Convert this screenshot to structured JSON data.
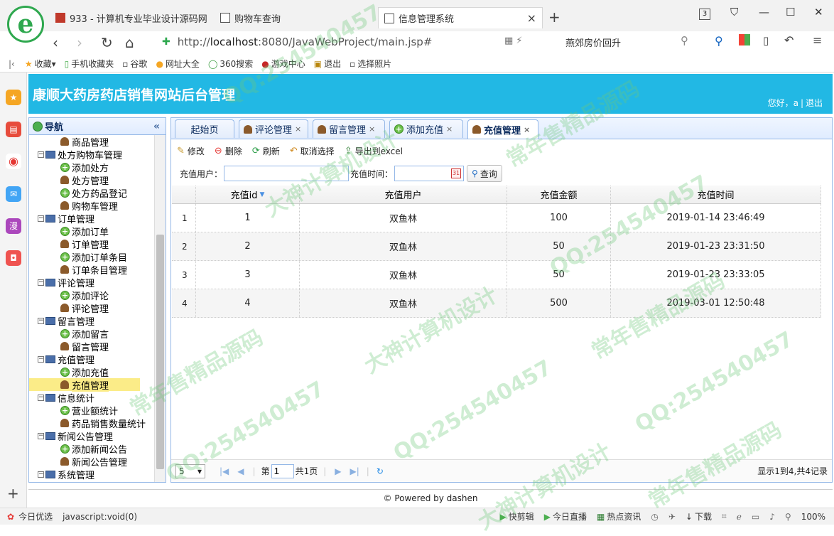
{
  "browser": {
    "tabs": [
      {
        "title": "933 - 计算机专业毕业设计源码网"
      },
      {
        "title": "购物车查询"
      },
      {
        "title": "信息管理系统"
      }
    ],
    "tab_count": "3",
    "url_scheme": "http://",
    "url_host": "localhost",
    "url_rest": ":8080/JavaWebProject/main.jsp#",
    "news_hint": "燕郊房价回升",
    "bookmarks": [
      "收藏",
      "手机收藏夹",
      "谷歌",
      "网址大全",
      "360搜索",
      "游戏中心",
      "退出",
      "选择照片"
    ],
    "status_left": "今日优选",
    "status_link": "javascript:void(0)",
    "status_items": [
      "快剪辑",
      "今日直播",
      "热点资讯",
      "下载"
    ],
    "zoom": "100%"
  },
  "app": {
    "title": "康顺大药房药店销售网站后台管理",
    "greeting": "您好，a",
    "logout": "退出",
    "nav_title": "导航",
    "footer": "© Powered by dashen"
  },
  "tree": [
    {
      "level": 2,
      "icon": "user",
      "label": "商品管理"
    },
    {
      "level": 1,
      "icon": "folder",
      "label": "处方购物车管理"
    },
    {
      "level": 2,
      "icon": "add",
      "label": "添加处方"
    },
    {
      "level": 2,
      "icon": "user",
      "label": "处方管理"
    },
    {
      "level": 2,
      "icon": "add",
      "label": "处方药品登记"
    },
    {
      "level": 2,
      "icon": "user",
      "label": "购物车管理"
    },
    {
      "level": 1,
      "icon": "folder",
      "label": "订单管理"
    },
    {
      "level": 2,
      "icon": "add",
      "label": "添加订单"
    },
    {
      "level": 2,
      "icon": "user",
      "label": "订单管理"
    },
    {
      "level": 2,
      "icon": "add",
      "label": "添加订单条目"
    },
    {
      "level": 2,
      "icon": "user",
      "label": "订单条目管理"
    },
    {
      "level": 1,
      "icon": "folder",
      "label": "评论管理"
    },
    {
      "level": 2,
      "icon": "add",
      "label": "添加评论"
    },
    {
      "level": 2,
      "icon": "user",
      "label": "评论管理"
    },
    {
      "level": 1,
      "icon": "folder",
      "label": "留言管理"
    },
    {
      "level": 2,
      "icon": "add",
      "label": "添加留言"
    },
    {
      "level": 2,
      "icon": "user",
      "label": "留言管理"
    },
    {
      "level": 1,
      "icon": "folder",
      "label": "充值管理"
    },
    {
      "level": 2,
      "icon": "add",
      "label": "添加充值"
    },
    {
      "level": 2,
      "icon": "user",
      "label": "充值管理",
      "selected": true
    },
    {
      "level": 1,
      "icon": "folder",
      "label": "信息统计"
    },
    {
      "level": 2,
      "icon": "add",
      "label": "营业额统计"
    },
    {
      "level": 2,
      "icon": "user",
      "label": "药品销售数量统计"
    },
    {
      "level": 1,
      "icon": "folder",
      "label": "新闻公告管理"
    },
    {
      "level": 2,
      "icon": "add",
      "label": "添加新闻公告"
    },
    {
      "level": 2,
      "icon": "user",
      "label": "新闻公告管理"
    },
    {
      "level": 1,
      "icon": "folder",
      "label": "系统管理"
    }
  ],
  "page_tabs": [
    {
      "label": "起始页",
      "icon": "",
      "closable": false
    },
    {
      "label": "评论管理",
      "icon": "user",
      "closable": true
    },
    {
      "label": "留言管理",
      "icon": "user",
      "closable": true
    },
    {
      "label": "添加充值",
      "icon": "add",
      "closable": true
    },
    {
      "label": "充值管理",
      "icon": "user",
      "closable": true,
      "active": true
    }
  ],
  "toolbar": {
    "edit": "修改",
    "delete": "删除",
    "refresh": "刷新",
    "unselect": "取消选择",
    "export": "导出到excel"
  },
  "search": {
    "user_label": "充值用户：",
    "user_value": "",
    "time_label": "充值时间：",
    "time_value": "",
    "button": "查询"
  },
  "grid": {
    "columns": [
      "充值id",
      "充值用户",
      "充值金额",
      "充值时间"
    ],
    "rows": [
      {
        "n": "1",
        "id": "1",
        "user": "双鱼林",
        "amount": "100",
        "time": "2019-01-14 23:46:49"
      },
      {
        "n": "2",
        "id": "2",
        "user": "双鱼林",
        "amount": "50",
        "time": "2019-01-23 23:31:50"
      },
      {
        "n": "3",
        "id": "3",
        "user": "双鱼林",
        "amount": "50",
        "time": "2019-01-23 23:33:05"
      },
      {
        "n": "4",
        "id": "4",
        "user": "双鱼林",
        "amount": "500",
        "time": "2019-03-01 12:50:48"
      }
    ]
  },
  "pager": {
    "page_size": "5",
    "page_prefix": "第",
    "page_value": "1",
    "page_suffix": "共1页",
    "info": "显示1到4,共4记录"
  },
  "watermarks": [
    "QQ:254540457",
    "常年售精品源码",
    "大神计算机设计"
  ]
}
